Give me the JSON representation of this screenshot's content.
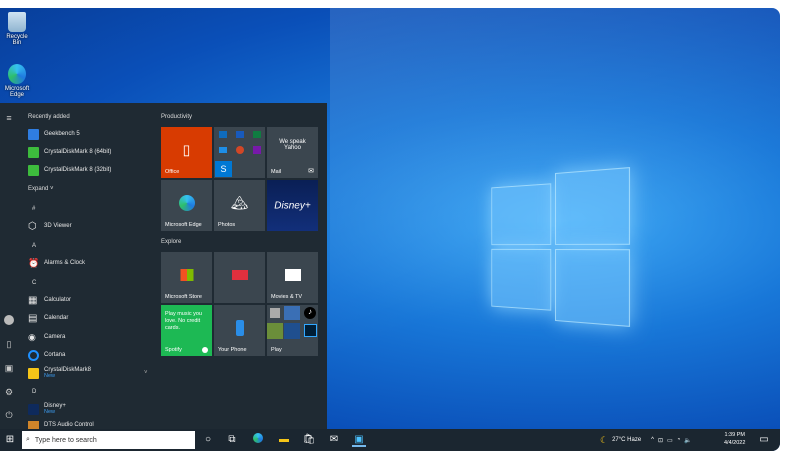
{
  "desktop": {
    "icons": [
      {
        "label": "Recycle Bin",
        "icon": "recycle-bin-icon"
      },
      {
        "label": "Microsoft Edge",
        "icon": "edge-icon"
      }
    ]
  },
  "start_menu": {
    "recently_added_label": "Recently added",
    "recent": [
      {
        "label": "Geekbench 5",
        "color": "#2f7de1"
      },
      {
        "label": "CrystalDiskMark 8 (64bit)",
        "color": "#3dbb3d"
      },
      {
        "label": "CrystalDiskMark 8 (32bit)",
        "color": "#3dbb3d"
      }
    ],
    "expand_label": "Expand",
    "apps": [
      {
        "type": "header",
        "label": "#"
      },
      {
        "type": "app",
        "label": "3D Viewer",
        "glyph": "⬡"
      },
      {
        "type": "header",
        "label": "A"
      },
      {
        "type": "app",
        "label": "Alarms & Clock",
        "glyph": "⏰"
      },
      {
        "type": "header",
        "label": "C"
      },
      {
        "type": "app",
        "label": "Calculator",
        "glyph": "▦"
      },
      {
        "type": "app",
        "label": "Calendar",
        "glyph": "▤"
      },
      {
        "type": "app",
        "label": "Camera",
        "glyph": "◉"
      },
      {
        "type": "app",
        "label": "Cortana",
        "glyph": "○"
      },
      {
        "type": "app",
        "label": "CrystalDiskMark8",
        "badge": "New",
        "glyph": "▬"
      },
      {
        "type": "header",
        "label": "D"
      },
      {
        "type": "app",
        "label": "Disney+",
        "badge": "New",
        "glyph": "D"
      },
      {
        "type": "app",
        "label": "DTS Audio Control",
        "glyph": "●"
      }
    ],
    "groups": [
      {
        "label": "Productivity"
      },
      {
        "label": "Explore"
      }
    ],
    "tiles": {
      "office": "Office",
      "mail": "Mail",
      "mail_text": "We speak Yahoo",
      "edge": "Microsoft Edge",
      "photos": "Photos",
      "disney": "Disney+",
      "store": "Microsoft Store",
      "news": "",
      "movies": "Movies & TV",
      "spotify": "Spotify",
      "spotify_text": "Play music you love. No credit cards.",
      "phone": "Your Phone",
      "play": "Play"
    }
  },
  "taskbar": {
    "search_placeholder": "Type here to search",
    "weather": "27°C  Haze",
    "time": "1:39 PM",
    "date": "4/4/2022"
  },
  "colors": {
    "office": "#d83b01",
    "spotify": "#1db954",
    "accent": "#0078d7"
  }
}
